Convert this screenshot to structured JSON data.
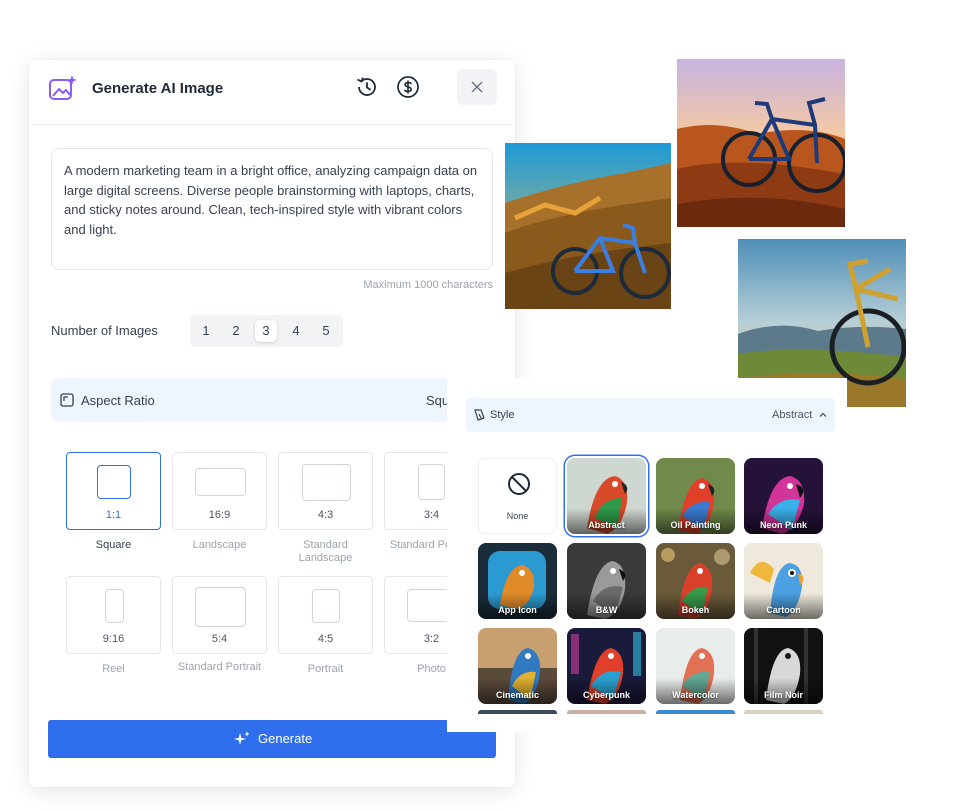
{
  "header": {
    "title": "Generate AI Image",
    "icons": [
      "ai-image-sparkle-icon",
      "history-icon",
      "credits-dollar-icon",
      "close-icon"
    ]
  },
  "prompt": {
    "value": "A modern marketing team in a bright office, analyzing campaign data on large digital screens. Diverse people brainstorming with laptops, charts, and sticky notes around. Clean, tech-inspired style with vibrant colors and light.",
    "limit_text": "Maximum 1000 characters"
  },
  "num_images": {
    "label": "Number of Images",
    "options": [
      "1",
      "2",
      "3",
      "4",
      "5"
    ],
    "selected": "3"
  },
  "aspect": {
    "label": "Aspect Ratio",
    "value": "Square",
    "options": [
      {
        "ratio": "1:1",
        "caption": "Square"
      },
      {
        "ratio": "16:9",
        "caption": "Landscape"
      },
      {
        "ratio": "4:3",
        "caption": "Standard Landscape"
      },
      {
        "ratio": "3:4",
        "caption": "Standard Portrait"
      },
      {
        "ratio": "9:16",
        "caption": "Reel"
      },
      {
        "ratio": "5:4",
        "caption": "Standard Portrait"
      },
      {
        "ratio": "4:5",
        "caption": "Portrait"
      },
      {
        "ratio": "3:2",
        "caption": "Photo"
      }
    ],
    "selected": "1:1"
  },
  "generate": {
    "label": "Generate"
  },
  "style": {
    "label": "Style",
    "value": "Abstract",
    "options": [
      "None",
      "Abstract",
      "Oil Painting",
      "Neon Punk",
      "App Icon",
      "B&W",
      "Bokeh",
      "Cartoon",
      "Cinematic",
      "Cyberpunk",
      "Watercolor",
      "Film Noir"
    ],
    "selected": "Abstract"
  },
  "colors": {
    "accent": "#2f6fed",
    "brand_purple": "#8b5cf6",
    "selected_bg": "#eef5fe"
  }
}
